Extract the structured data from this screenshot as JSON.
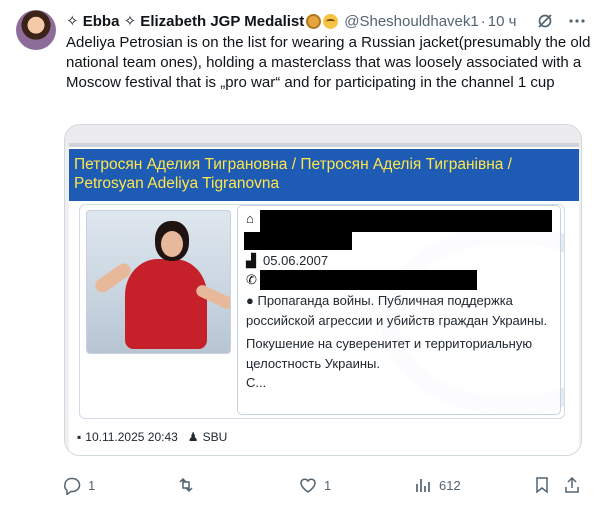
{
  "author": {
    "display_name": "✧ Ebba ✧ Elizabeth JGP Medalist",
    "handle": "@Sheshouldhavek1",
    "separator": "·",
    "time": "10 ч"
  },
  "tweet": {
    "text": "Adeliya Petrosian is on the list for wearing a Russian jacket(presumably the old national team ones), holding a masterclass that was loosely associated with a Moscow festival that is „pro war“ and for participating in the channel 1 cup"
  },
  "document": {
    "banner_line1": "Петросян Аделия Тиграновна / Петросян Аделія Тигранівна /",
    "banner_line2": "Petrosyan Adeliya Tigranovna",
    "birth_date": "05.06.2007",
    "reason_1": "Пропаганда войны. Публичная поддержка российской агрессии и убийств граждан Украины.",
    "reason_2": "Покушение на суверенитет и территориальную целостность Украины.",
    "reason_3": "С...",
    "footer_date": "10.11.2025 20:43",
    "footer_source": "SBU"
  },
  "actions": {
    "replies": "1",
    "reposts": "",
    "likes": "1",
    "views": "612"
  },
  "colors": {
    "banner_bg": "#1e5bb5",
    "banner_text": "#ffe74a",
    "muted": "#536471"
  }
}
